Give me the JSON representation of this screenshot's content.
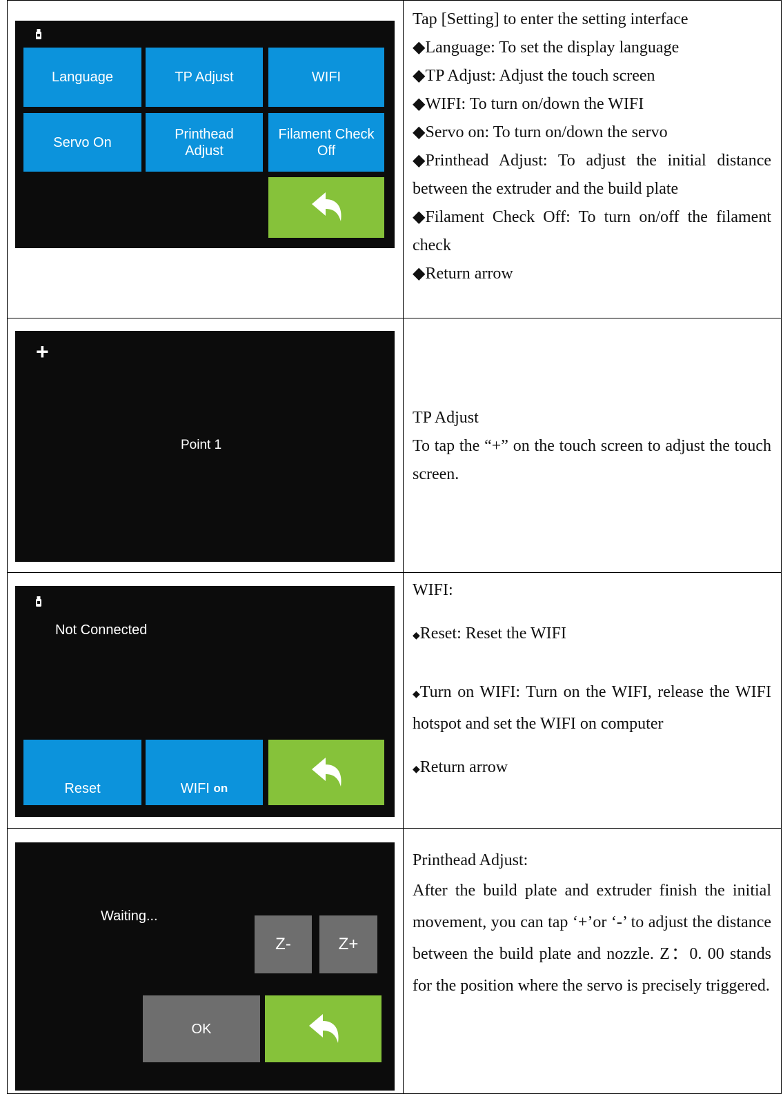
{
  "row1": {
    "tiles": [
      "Language",
      "TP Adjust",
      "WIFI",
      "Servo On",
      "Printhead\nAdjust",
      "Filament Check\nOff"
    ],
    "description": {
      "intro": "Tap [Setting] to enter the setting interface",
      "bullets": [
        "Language: To set the display language",
        "TP Adjust: Adjust the touch screen",
        "WIFI: To turn on/down the WIFI",
        "Servo on: To turn on/down the servo",
        "Printhead Adjust: To adjust the initial distance between the extruder and the build plate",
        "Filament Check Off: To turn on/off the filament check",
        "Return arrow"
      ]
    }
  },
  "row2": {
    "plus": "+",
    "point_label": "Point 1",
    "description": {
      "title": "TP Adjust",
      "text": "To tap the “+” on the touch screen to adjust the touch screen."
    }
  },
  "row3": {
    "status": "Not Connected",
    "reset_label": "Reset",
    "wifi_label": "WIFI",
    "wifi_state": "on",
    "description": {
      "title": "WIFI:",
      "bullet_reset": "Reset: Reset the WIFI",
      "bullet_turn_on": "Turn on WIFI: Turn on the WIFI, release the WIFI hotspot and set the WIFI on computer",
      "bullet_return": "Return arrow"
    }
  },
  "row4": {
    "waiting": "Waiting...",
    "z_minus": "Z-",
    "z_plus": "Z+",
    "ok_label": "OK",
    "description": {
      "title": "Printhead Adjust:",
      "text": "After the build plate and extruder finish the initial movement, you can tap ‘+’or ‘-’ to adjust the distance between the build plate and nozzle. Z：0. 00 stands for the position where the servo is precisely triggered."
    }
  },
  "bullet_glyph": "◆",
  "colors": {
    "tile_blue": "#0c93dc",
    "return_green": "#86c23a",
    "tile_gray": "#6e6e6e",
    "screen_black": "#0c0c0c"
  }
}
